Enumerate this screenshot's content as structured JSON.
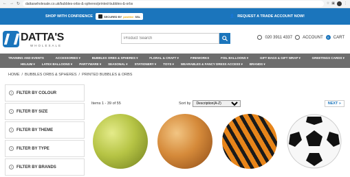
{
  "browser": {
    "url": "dattaswholesale.co.uk/bubbles-orbs-&-spheres/printed-bubbles-&-orbs"
  },
  "promo": {
    "left_text": "SHOP WITH CONFIDENCE",
    "badge_prefix": "SECURED BY",
    "badge_brand": "positive",
    "badge_suffix": "SSL",
    "right_text": "REQUEST A TRADE ACCOUNT NOW!"
  },
  "header": {
    "logo_name": "DATTA'S",
    "logo_sub": "WHOLESALE",
    "search_placeholder": "Product Search",
    "phone": "020 3911 4337",
    "account_label": "ACCOUNT",
    "cart_label": "CART",
    "cart_count": "0"
  },
  "menu": {
    "row1": [
      "TRAINING AND EVENTS",
      "ACCESSORIES ▾",
      "BUBBLES ORBS & SPHERES ▾",
      "FLORAL & CRAFT ▾",
      "FIREWORKS",
      "FOIL BALLOONS ▾",
      "GIFT BAGS & GIFT WRAP ▾",
      "GREETINGS CARDS ▾"
    ],
    "row2": [
      "HELIUM ▾",
      "LATEX BALLOONS ▾",
      "PARTYWARE ▾",
      "SEASONAL ▾",
      "STATIONERY ▾",
      "TOYS ▾",
      "WEARABLES & FANCY DRESS ACCESS ▾",
      "BRANDS ▾"
    ]
  },
  "breadcrumb": [
    "HOME",
    "/",
    "BUBBLES ORBS & SPHERES",
    "/",
    "PRINTED BUBBLES & ORBS"
  ],
  "filters": [
    "FILTER BY COLOUR",
    "FILTER BY SIZE",
    "FILTER BY THEME",
    "FILTER BY TYPE",
    "FILTER BY BRANDS"
  ],
  "toolbar": {
    "items_text": "Items 1 - 39 of 55",
    "sort_label": "Sort by",
    "sort_value": "Description(A-Z)",
    "next_label": "NEXT »"
  },
  "products": [
    {
      "name": "crocodile-orb"
    },
    {
      "name": "giraffe-orb"
    },
    {
      "name": "tiger-orb"
    },
    {
      "name": "football-orb"
    }
  ]
}
